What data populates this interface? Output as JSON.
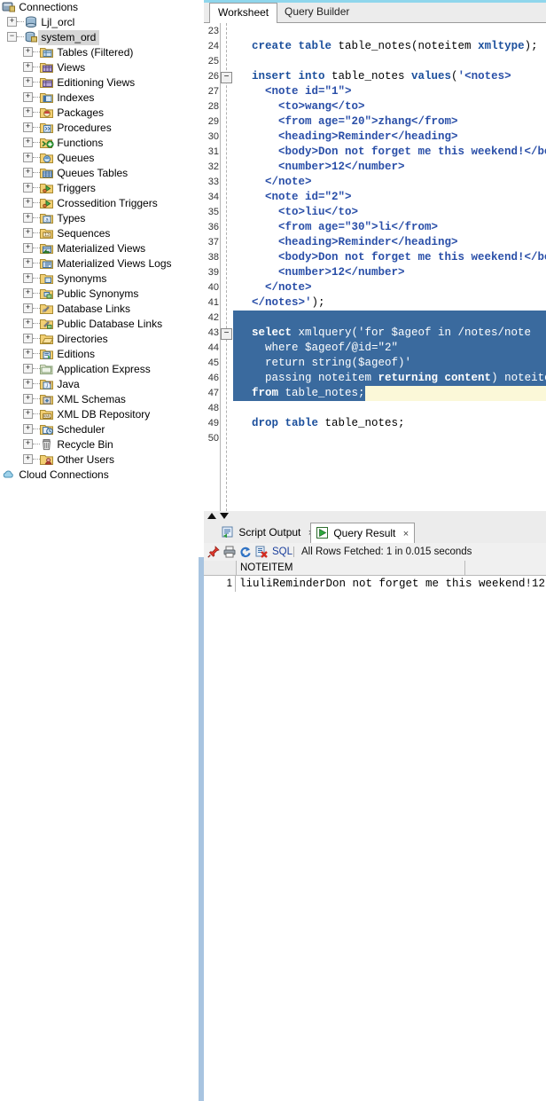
{
  "connections": {
    "root_label": "Connections",
    "cloud_label": "Cloud Connections",
    "databases": [
      {
        "label": "Ljl_orcl",
        "expanded": false,
        "selected": false
      },
      {
        "label": "system_ord",
        "expanded": true,
        "selected": true
      }
    ],
    "children": [
      {
        "label": "Tables (Filtered)",
        "icon": "table-filtered-icon"
      },
      {
        "label": "Views",
        "icon": "view-icon"
      },
      {
        "label": "Editioning Views",
        "icon": "editioning-view-icon"
      },
      {
        "label": "Indexes",
        "icon": "index-icon"
      },
      {
        "label": "Packages",
        "icon": "package-icon"
      },
      {
        "label": "Procedures",
        "icon": "procedure-icon"
      },
      {
        "label": "Functions",
        "icon": "function-icon"
      },
      {
        "label": "Queues",
        "icon": "queue-icon"
      },
      {
        "label": "Queues Tables",
        "icon": "queue-table-icon"
      },
      {
        "label": "Triggers",
        "icon": "trigger-icon"
      },
      {
        "label": "Crossedition Triggers",
        "icon": "crossedition-trigger-icon"
      },
      {
        "label": "Types",
        "icon": "type-icon"
      },
      {
        "label": "Sequences",
        "icon": "sequence-icon"
      },
      {
        "label": "Materialized Views",
        "icon": "materialized-view-icon"
      },
      {
        "label": "Materialized Views Logs",
        "icon": "materialized-view-log-icon"
      },
      {
        "label": "Synonyms",
        "icon": "synonym-icon"
      },
      {
        "label": "Public Synonyms",
        "icon": "public-synonym-icon"
      },
      {
        "label": "Database Links",
        "icon": "database-link-icon"
      },
      {
        "label": "Public Database Links",
        "icon": "public-database-link-icon"
      },
      {
        "label": "Directories",
        "icon": "directory-icon"
      },
      {
        "label": "Editions",
        "icon": "edition-icon"
      },
      {
        "label": "Application Express",
        "icon": "apex-icon"
      },
      {
        "label": "Java",
        "icon": "java-icon"
      },
      {
        "label": "XML Schemas",
        "icon": "xml-schema-icon"
      },
      {
        "label": "XML DB Repository",
        "icon": "xml-db-repository-icon"
      },
      {
        "label": "Scheduler",
        "icon": "scheduler-icon"
      },
      {
        "label": "Recycle Bin",
        "icon": "recycle-bin-icon"
      },
      {
        "label": "Other Users",
        "icon": "other-users-icon"
      }
    ]
  },
  "editor": {
    "tabs": [
      {
        "label": "Worksheet",
        "active": true
      },
      {
        "label": "Query Builder",
        "active": false
      }
    ],
    "first_line": 23,
    "last_line": 50,
    "lines": [
      {
        "n": 23,
        "fold": false,
        "sel": false,
        "indent": 0,
        "tokens": []
      },
      {
        "n": 24,
        "fold": false,
        "sel": false,
        "indent": 1,
        "tokens": [
          {
            "t": "create ",
            "c": "kw"
          },
          {
            "t": "table ",
            "c": "kw"
          },
          {
            "t": "table_notes(noteitem ",
            "c": "pl"
          },
          {
            "t": "xmltype",
            "c": "kw"
          },
          {
            "t": ");",
            "c": "pl"
          }
        ]
      },
      {
        "n": 25,
        "fold": false,
        "sel": false,
        "indent": 0,
        "tokens": []
      },
      {
        "n": 26,
        "fold": true,
        "sel": false,
        "indent": 1,
        "tokens": [
          {
            "t": "insert into ",
            "c": "kw"
          },
          {
            "t": "table_notes ",
            "c": "pl"
          },
          {
            "t": "values",
            "c": "kw"
          },
          {
            "t": "(",
            "c": "pl"
          },
          {
            "t": "'<notes>",
            "c": "str"
          }
        ]
      },
      {
        "n": 27,
        "fold": false,
        "sel": false,
        "indent": 2,
        "tokens": [
          {
            "t": "<note id=\"1\">",
            "c": "str"
          }
        ]
      },
      {
        "n": 28,
        "fold": false,
        "sel": false,
        "indent": 3,
        "tokens": [
          {
            "t": "<to>wang</to>",
            "c": "str"
          }
        ]
      },
      {
        "n": 29,
        "fold": false,
        "sel": false,
        "indent": 3,
        "tokens": [
          {
            "t": "<from age=\"20\">zhang</from>",
            "c": "str"
          }
        ]
      },
      {
        "n": 30,
        "fold": false,
        "sel": false,
        "indent": 3,
        "tokens": [
          {
            "t": "<heading>Reminder</heading>",
            "c": "str"
          }
        ]
      },
      {
        "n": 31,
        "fold": false,
        "sel": false,
        "indent": 3,
        "tokens": [
          {
            "t": "<body>Don not forget me this weekend!</body>",
            "c": "str"
          }
        ]
      },
      {
        "n": 32,
        "fold": false,
        "sel": false,
        "indent": 3,
        "tokens": [
          {
            "t": "<number>12</number>",
            "c": "str"
          }
        ]
      },
      {
        "n": 33,
        "fold": false,
        "sel": false,
        "indent": 2,
        "tokens": [
          {
            "t": "</note>",
            "c": "str"
          }
        ]
      },
      {
        "n": 34,
        "fold": false,
        "sel": false,
        "indent": 2,
        "tokens": [
          {
            "t": "<note id=\"2\">",
            "c": "str"
          }
        ]
      },
      {
        "n": 35,
        "fold": false,
        "sel": false,
        "indent": 3,
        "tokens": [
          {
            "t": "<to>liu</to>",
            "c": "str"
          }
        ]
      },
      {
        "n": 36,
        "fold": false,
        "sel": false,
        "indent": 3,
        "tokens": [
          {
            "t": "<from age=\"30\">li</from>",
            "c": "str"
          }
        ]
      },
      {
        "n": 37,
        "fold": false,
        "sel": false,
        "indent": 3,
        "tokens": [
          {
            "t": "<heading>Reminder</heading>",
            "c": "str"
          }
        ]
      },
      {
        "n": 38,
        "fold": false,
        "sel": false,
        "indent": 3,
        "tokens": [
          {
            "t": "<body>Don not forget me this weekend!</body>",
            "c": "str"
          }
        ]
      },
      {
        "n": 39,
        "fold": false,
        "sel": false,
        "indent": 3,
        "tokens": [
          {
            "t": "<number>12</number>",
            "c": "str"
          }
        ]
      },
      {
        "n": 40,
        "fold": false,
        "sel": false,
        "indent": 2,
        "tokens": [
          {
            "t": "</note>",
            "c": "str"
          }
        ]
      },
      {
        "n": 41,
        "fold": false,
        "sel": false,
        "indent": 1,
        "tokens": [
          {
            "t": "</notes>'",
            "c": "str"
          },
          {
            "t": ");",
            "c": "pl"
          }
        ]
      },
      {
        "n": 42,
        "fold": false,
        "sel": true,
        "indent": 0,
        "tokens": []
      },
      {
        "n": 43,
        "fold": true,
        "sel": true,
        "indent": 1,
        "tokens": [
          {
            "t": "select ",
            "c": "kw"
          },
          {
            "t": "xmlquery('for $ageof in /notes/note",
            "c": "pl"
          }
        ]
      },
      {
        "n": 44,
        "fold": false,
        "sel": true,
        "indent": 2,
        "tokens": [
          {
            "t": "where $ageof/@id=\"2\"",
            "c": "pl"
          }
        ]
      },
      {
        "n": 45,
        "fold": false,
        "sel": true,
        "indent": 2,
        "tokens": [
          {
            "t": "return string($ageof)'",
            "c": "pl"
          }
        ]
      },
      {
        "n": 46,
        "fold": false,
        "sel": true,
        "indent": 2,
        "tokens": [
          {
            "t": "passing noteitem ",
            "c": "pl"
          },
          {
            "t": "returning content",
            "c": "kw"
          },
          {
            "t": ") noteitem",
            "c": "pl"
          }
        ]
      },
      {
        "n": 47,
        "fold": false,
        "sel": true,
        "curline": true,
        "indent": 1,
        "tokens": [
          {
            "t": "from ",
            "c": "kw"
          },
          {
            "t": "table_notes;",
            "c": "pl"
          }
        ]
      },
      {
        "n": 48,
        "fold": false,
        "sel": false,
        "indent": 0,
        "tokens": []
      },
      {
        "n": 49,
        "fold": false,
        "sel": false,
        "indent": 1,
        "tokens": [
          {
            "t": "drop table ",
            "c": "kw"
          },
          {
            "t": "table_notes;",
            "c": "pl"
          }
        ]
      },
      {
        "n": 50,
        "fold": false,
        "sel": false,
        "indent": 0,
        "tokens": []
      }
    ]
  },
  "results": {
    "tabs": [
      {
        "label": "Script Output",
        "active": false,
        "icon": "script-output-icon",
        "close": "×"
      },
      {
        "label": "Query Result",
        "active": true,
        "icon": "play-icon",
        "close": "×"
      }
    ],
    "toolbar": {
      "pin": "pin-icon",
      "print": "print-icon",
      "refresh": "refresh-icon",
      "clear": "clear-icon",
      "sql_label": "SQL",
      "status": "All Rows Fetched: 1 in 0.015 seconds"
    },
    "grid": {
      "columns": [
        "NOTEITEM"
      ],
      "rows": [
        {
          "num": "1",
          "cells": [
            "liuliReminderDon not forget me this weekend!12"
          ]
        }
      ]
    }
  },
  "colors": {
    "accent_blue": "#8fd6ec",
    "selection_blue": "#3a6a9e",
    "current_line": "#fbf8d8",
    "keyword": "#1b4f9c",
    "string": "#2a4fa8",
    "chrome": "#ececec"
  }
}
